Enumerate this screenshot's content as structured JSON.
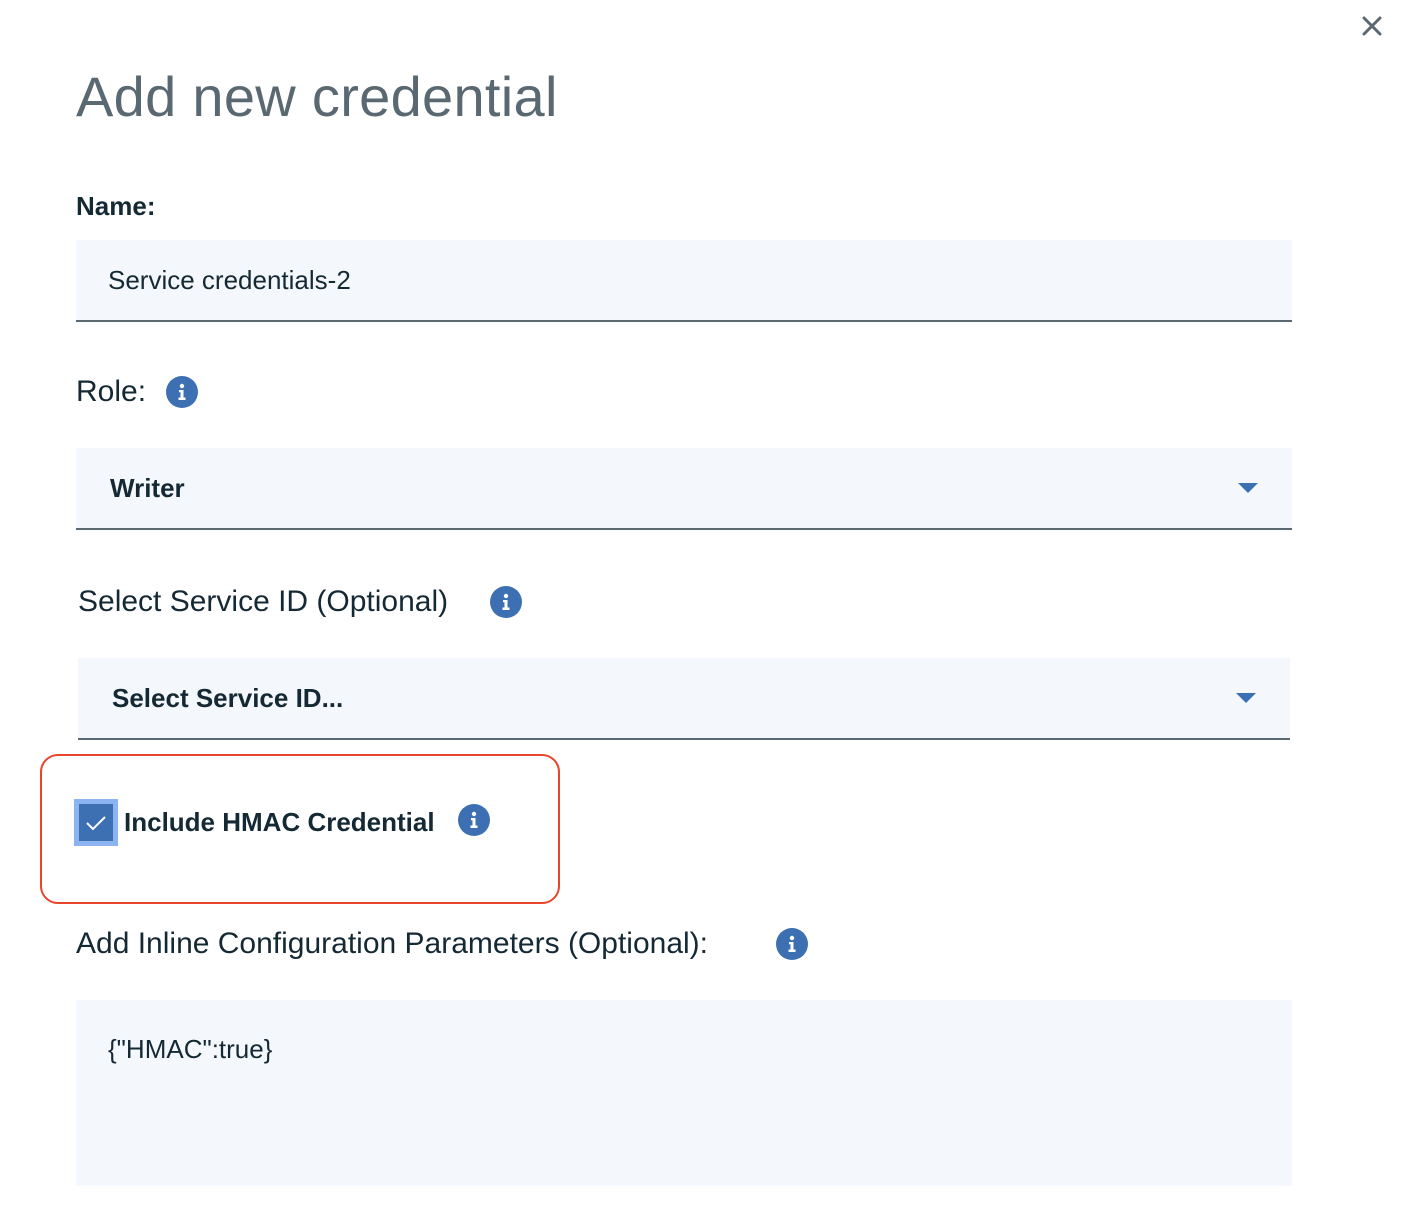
{
  "dialog": {
    "title": "Add new credential",
    "close_icon": "close-icon"
  },
  "name": {
    "label": "Name:",
    "value": "Service credentials-2"
  },
  "role": {
    "label": "Role:",
    "info_icon": "info-icon",
    "selected": "Writer"
  },
  "service_id": {
    "label": "Select Service ID (Optional)",
    "info_icon": "info-icon",
    "selected": "Select Service ID..."
  },
  "hmac": {
    "label": "Include HMAC Credential",
    "checked": true,
    "info_icon": "info-icon",
    "highlight_color": "#e8452c"
  },
  "inline_params": {
    "label": "Add Inline Configuration Parameters (Optional):",
    "info_icon": "info-icon",
    "value": "{\"HMAC\":true}"
  },
  "colors": {
    "accent": "#3d70b2",
    "field_bg": "#f4f7fb",
    "text": "#152935",
    "title": "#5a6872"
  }
}
